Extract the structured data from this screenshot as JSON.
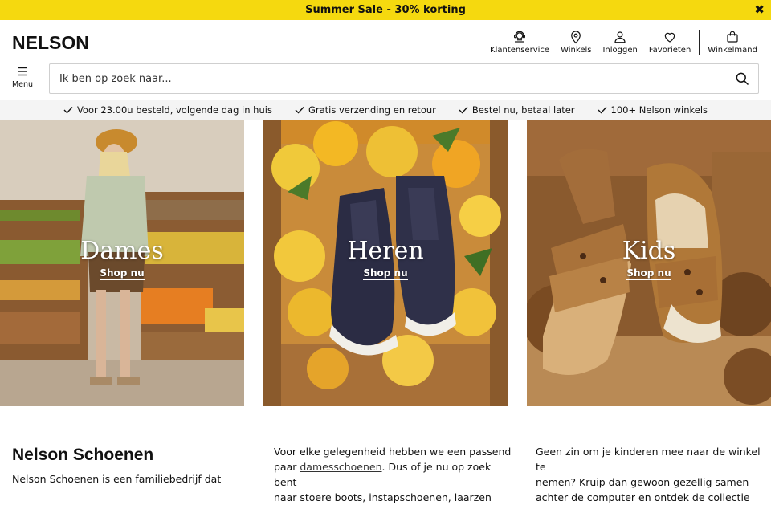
{
  "promo": {
    "text": "Summer Sale - 30% korting",
    "close_icon": "close-icon",
    "color": "#f5d90f"
  },
  "header": {
    "logo": "NELSON",
    "nav": [
      {
        "label": "Klantenservice",
        "icon": "customer-service-icon"
      },
      {
        "label": "Winkels",
        "icon": "location-pin-icon"
      },
      {
        "label": "Inloggen",
        "icon": "user-icon"
      },
      {
        "label": "Favorieten",
        "icon": "heart-icon"
      },
      {
        "label": "Winkelmand",
        "icon": "shopping-bag-icon"
      }
    ]
  },
  "menu": {
    "label": "Menu",
    "icon": "hamburger-icon"
  },
  "search": {
    "placeholder": "Ik ben op zoek naar...",
    "value": "",
    "icon": "search-icon"
  },
  "usps": [
    "Voor 23.00u besteld, volgende dag in huis",
    "Gratis verzending en retour",
    "Bestel nu, betaal later",
    "100+ Nelson winkels"
  ],
  "tiles": [
    {
      "title": "Dames",
      "cta": "Shop nu"
    },
    {
      "title": "Heren",
      "cta": "Shop nu"
    },
    {
      "title": "Kids",
      "cta": "Shop nu"
    }
  ],
  "content": {
    "heading": "Nelson Schoenen",
    "col1_text": "Nelson Schoenen is een familiebedrijf dat",
    "col2_line1": "Voor elke gelegenheid hebben we een passend",
    "col2_line2_pre": "paar ",
    "col2_link": "damesschoenen",
    "col2_line2_post": ". Dus of je nu op zoek bent",
    "col2_line3": "naar stoere boots, instapschoenen, laarzen",
    "col3_line1": "Geen zin om je kinderen mee naar de winkel te",
    "col3_line2": "nemen? Kruip dan gewoon gezellig samen",
    "col3_line3": "achter de computer en ontdek de collectie"
  }
}
